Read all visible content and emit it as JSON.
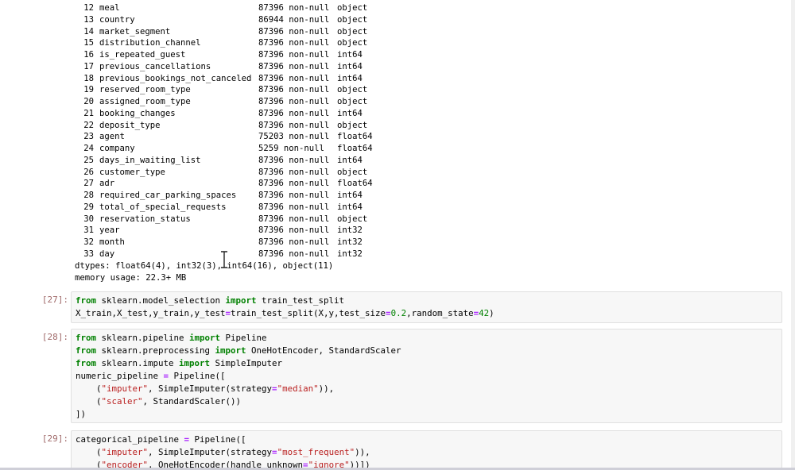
{
  "info_output": {
    "rows": [
      {
        "num": "12",
        "column": "meal",
        "count": "87396 non-null",
        "dtype": "object"
      },
      {
        "num": "13",
        "column": "country",
        "count": "86944 non-null",
        "dtype": "object"
      },
      {
        "num": "14",
        "column": "market_segment",
        "count": "87396 non-null",
        "dtype": "object"
      },
      {
        "num": "15",
        "column": "distribution_channel",
        "count": "87396 non-null",
        "dtype": "object"
      },
      {
        "num": "16",
        "column": "is_repeated_guest",
        "count": "87396 non-null",
        "dtype": "int64"
      },
      {
        "num": "17",
        "column": "previous_cancellations",
        "count": "87396 non-null",
        "dtype": "int64"
      },
      {
        "num": "18",
        "column": "previous_bookings_not_canceled",
        "count": "87396 non-null",
        "dtype": "int64"
      },
      {
        "num": "19",
        "column": "reserved_room_type",
        "count": "87396 non-null",
        "dtype": "object"
      },
      {
        "num": "20",
        "column": "assigned_room_type",
        "count": "87396 non-null",
        "dtype": "object"
      },
      {
        "num": "21",
        "column": "booking_changes",
        "count": "87396 non-null",
        "dtype": "int64"
      },
      {
        "num": "22",
        "column": "deposit_type",
        "count": "87396 non-null",
        "dtype": "object"
      },
      {
        "num": "23",
        "column": "agent",
        "count": "75203 non-null",
        "dtype": "float64"
      },
      {
        "num": "24",
        "column": "company",
        "count": "5259 non-null",
        "dtype": "float64"
      },
      {
        "num": "25",
        "column": "days_in_waiting_list",
        "count": "87396 non-null",
        "dtype": "int64"
      },
      {
        "num": "26",
        "column": "customer_type",
        "count": "87396 non-null",
        "dtype": "object"
      },
      {
        "num": "27",
        "column": "adr",
        "count": "87396 non-null",
        "dtype": "float64"
      },
      {
        "num": "28",
        "column": "required_car_parking_spaces",
        "count": "87396 non-null",
        "dtype": "int64"
      },
      {
        "num": "29",
        "column": "total_of_special_requests",
        "count": "87396 non-null",
        "dtype": "int64"
      },
      {
        "num": "30",
        "column": "reservation_status",
        "count": "87396 non-null",
        "dtype": "object"
      },
      {
        "num": "31",
        "column": "year",
        "count": "87396 non-null",
        "dtype": "int32"
      },
      {
        "num": "32",
        "column": "month",
        "count": "87396 non-null",
        "dtype": "int32"
      },
      {
        "num": "33",
        "column": "day",
        "count": "87396 non-null",
        "dtype": "int32"
      }
    ],
    "dtypes": "dtypes: float64(4), int32(3), int64(16), object(11)",
    "memory": "memory usage: 22.3+ MB"
  },
  "cells": [
    {
      "prompt": "[27]:",
      "lines": [
        [
          {
            "t": "from",
            "c": "kw"
          },
          {
            "t": " sklearn.model_selection ",
            "c": ""
          },
          {
            "t": "import",
            "c": "kw"
          },
          {
            "t": " train_test_split",
            "c": ""
          }
        ],
        [
          {
            "t": "X_train,X_test,y_train,y_test",
            "c": ""
          },
          {
            "t": "=",
            "c": "op"
          },
          {
            "t": "train_test_split(X,y,test_size",
            "c": ""
          },
          {
            "t": "=",
            "c": "op"
          },
          {
            "t": "0.2",
            "c": "num"
          },
          {
            "t": ",random_state",
            "c": ""
          },
          {
            "t": "=",
            "c": "op"
          },
          {
            "t": "42",
            "c": "num"
          },
          {
            "t": ")",
            "c": ""
          }
        ]
      ]
    },
    {
      "prompt": "[28]:",
      "lines": [
        [
          {
            "t": "from",
            "c": "kw"
          },
          {
            "t": " sklearn.pipeline ",
            "c": ""
          },
          {
            "t": "import",
            "c": "kw"
          },
          {
            "t": " Pipeline",
            "c": ""
          }
        ],
        [
          {
            "t": "from",
            "c": "kw"
          },
          {
            "t": " sklearn.preprocessing ",
            "c": ""
          },
          {
            "t": "import",
            "c": "kw"
          },
          {
            "t": " OneHotEncoder, StandardScaler",
            "c": ""
          }
        ],
        [
          {
            "t": "from",
            "c": "kw"
          },
          {
            "t": " sklearn.impute ",
            "c": ""
          },
          {
            "t": "import",
            "c": "kw"
          },
          {
            "t": " SimpleImputer",
            "c": ""
          }
        ],
        [
          {
            "t": "numeric_pipeline ",
            "c": ""
          },
          {
            "t": "=",
            "c": "op"
          },
          {
            "t": " Pipeline([",
            "c": ""
          }
        ],
        [
          {
            "t": "    (",
            "c": ""
          },
          {
            "t": "\"imputer\"",
            "c": "str"
          },
          {
            "t": ", SimpleImputer(strategy",
            "c": ""
          },
          {
            "t": "=",
            "c": "op"
          },
          {
            "t": "\"median\"",
            "c": "str"
          },
          {
            "t": ")),",
            "c": ""
          }
        ],
        [
          {
            "t": "    (",
            "c": ""
          },
          {
            "t": "\"scaler\"",
            "c": "str"
          },
          {
            "t": ", StandardScaler())",
            "c": ""
          }
        ],
        [
          {
            "t": "])",
            "c": ""
          }
        ]
      ]
    },
    {
      "prompt": "[29]:",
      "lines": [
        [
          {
            "t": "categorical_pipeline ",
            "c": ""
          },
          {
            "t": "=",
            "c": "op"
          },
          {
            "t": " Pipeline([",
            "c": ""
          }
        ],
        [
          {
            "t": "    (",
            "c": ""
          },
          {
            "t": "\"imputer\"",
            "c": "str"
          },
          {
            "t": ", SimpleImputer(strategy",
            "c": ""
          },
          {
            "t": "=",
            "c": "op"
          },
          {
            "t": "\"most_frequent\"",
            "c": "str"
          },
          {
            "t": ")),",
            "c": ""
          }
        ],
        [
          {
            "t": "    (",
            "c": ""
          },
          {
            "t": "\"encoder\"",
            "c": "str"
          },
          {
            "t": ", OneHotEncoder(handle_unknown",
            "c": ""
          },
          {
            "t": "=",
            "c": "op"
          },
          {
            "t": "\"ignore\"",
            "c": "str"
          },
          {
            "t": "))])",
            "c": ""
          }
        ]
      ]
    }
  ]
}
